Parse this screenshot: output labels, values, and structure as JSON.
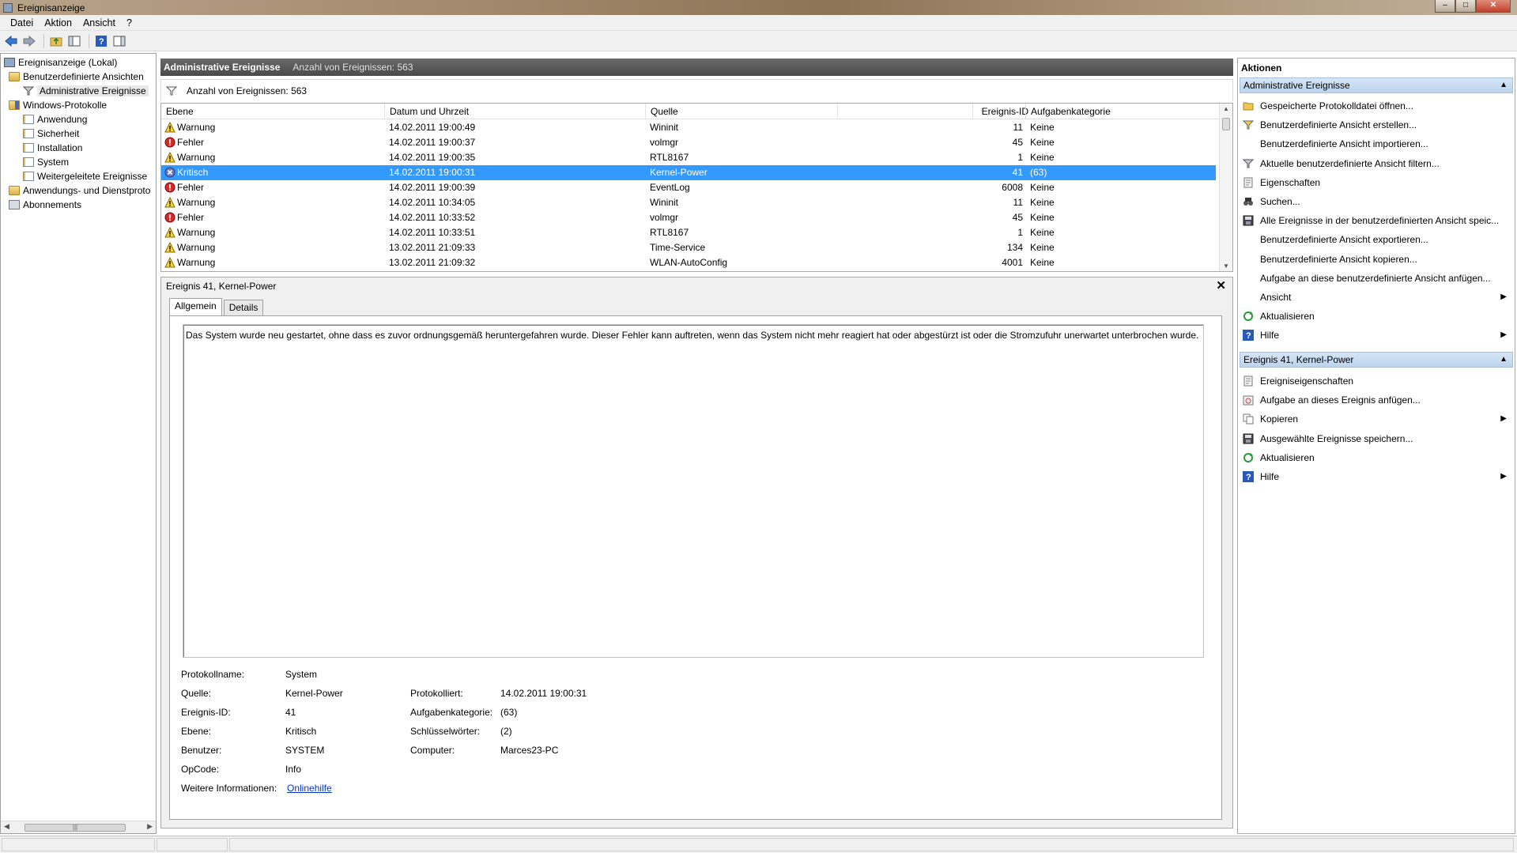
{
  "window": {
    "title": "Ereignisanzeige",
    "controls": {
      "minimize": "–",
      "maximize": "□",
      "close": "✕"
    }
  },
  "menu": [
    "Datei",
    "Aktion",
    "Ansicht",
    "?"
  ],
  "toolbar": {
    "icons": [
      "back-arrow",
      "forward-arrow",
      "up-folder",
      "show-hide-tree",
      "help",
      "show-hide-actions"
    ]
  },
  "tree": [
    {
      "label": "Ereignisanzeige (Lokal)",
      "icon": "computer",
      "level": 0
    },
    {
      "label": "Benutzerdefinierte Ansichten",
      "icon": "folder",
      "level": 1
    },
    {
      "label": "Administrative Ereignisse",
      "icon": "filter",
      "level": 2,
      "selected": true
    },
    {
      "label": "Windows-Protokolle",
      "icon": "folder",
      "level": 1
    },
    {
      "label": "Anwendung",
      "icon": "log",
      "level": 2
    },
    {
      "label": "Sicherheit",
      "icon": "log",
      "level": 2
    },
    {
      "label": "Installation",
      "icon": "log",
      "level": 2
    },
    {
      "label": "System",
      "icon": "log",
      "level": 2
    },
    {
      "label": "Weitergeleitete Ereignisse",
      "icon": "log",
      "level": 2
    },
    {
      "label": "Anwendungs- und Dienstproto",
      "icon": "folder",
      "level": 1
    },
    {
      "label": "Abonnements",
      "icon": "subscriptions",
      "level": 1
    }
  ],
  "center": {
    "header_title": "Administrative Ereignisse",
    "header_count": "Anzahl von Ereignissen: 563",
    "filter_text": "Anzahl von Ereignissen: 563",
    "columns": [
      "Ebene",
      "Datum und Uhrzeit",
      "Quelle",
      "Ereignis-ID",
      "Aufgabenkategorie"
    ],
    "rows": [
      {
        "level": "Warnung",
        "type": "warning",
        "datetime": "14.02.2011 19:00:49",
        "source": "Wininit",
        "id": "11",
        "category": "Keine"
      },
      {
        "level": "Fehler",
        "type": "error",
        "datetime": "14.02.2011 19:00:37",
        "source": "volmgr",
        "id": "45",
        "category": "Keine"
      },
      {
        "level": "Warnung",
        "type": "warning",
        "datetime": "14.02.2011 19:00:35",
        "source": "RTL8167",
        "id": "1",
        "category": "Keine"
      },
      {
        "level": "Kritisch",
        "type": "critical",
        "datetime": "14.02.2011 19:00:31",
        "source": "Kernel-Power",
        "id": "41",
        "category": "(63)",
        "selected": true
      },
      {
        "level": "Fehler",
        "type": "error",
        "datetime": "14.02.2011 19:00:39",
        "source": "EventLog",
        "id": "6008",
        "category": "Keine"
      },
      {
        "level": "Warnung",
        "type": "warning",
        "datetime": "14.02.2011 10:34:05",
        "source": "Wininit",
        "id": "11",
        "category": "Keine"
      },
      {
        "level": "Fehler",
        "type": "error",
        "datetime": "14.02.2011 10:33:52",
        "source": "volmgr",
        "id": "45",
        "category": "Keine"
      },
      {
        "level": "Warnung",
        "type": "warning",
        "datetime": "14.02.2011 10:33:51",
        "source": "RTL8167",
        "id": "1",
        "category": "Keine"
      },
      {
        "level": "Warnung",
        "type": "warning",
        "datetime": "13.02.2011 21:09:33",
        "source": "Time-Service",
        "id": "134",
        "category": "Keine"
      },
      {
        "level": "Warnung",
        "type": "warning",
        "datetime": "13.02.2011 21:09:32",
        "source": "WLAN-AutoConfig",
        "id": "4001",
        "category": "Keine"
      }
    ]
  },
  "detail": {
    "title": "Ereignis 41, Kernel-Power",
    "close": "✕",
    "tabs": [
      "Allgemein",
      "Details"
    ],
    "description": "Das System wurde neu gestartet, ohne dass es zuvor ordnungsgemäß heruntergefahren wurde. Dieser Fehler kann auftreten, wenn das System nicht mehr reagiert hat oder abgestürzt ist oder die Stromzufuhr unerwartet unterbrochen wurde.",
    "props": {
      "protokollname_label": "Protokollname:",
      "protokollname": "System",
      "quelle_label": "Quelle:",
      "quelle": "Kernel-Power",
      "protokolliert_label": "Protokolliert:",
      "protokolliert": "14.02.2011 19:00:31",
      "ereignis_id_label": "Ereignis-ID:",
      "ereignis_id": "41",
      "aufgabenkategorie_label": "Aufgabenkategorie:",
      "aufgabenkategorie": "(63)",
      "ebene_label": "Ebene:",
      "ebene": "Kritisch",
      "schluesselwoerter_label": "Schlüsselwörter:",
      "schluesselwoerter": "(2)",
      "benutzer_label": "Benutzer:",
      "benutzer": "SYSTEM",
      "computer_label": "Computer:",
      "computer": "Marces23-PC",
      "opcode_label": "OpCode:",
      "opcode": "Info",
      "weitere_label": "Weitere Informationen:",
      "weitere_link": "Onlinehilfe"
    }
  },
  "actions": {
    "title": "Aktionen",
    "section1": "Administrative Ereignisse",
    "section1_items": [
      {
        "label": "Gespeicherte Protokolldatei öffnen...",
        "icon": "folder-open"
      },
      {
        "label": "Benutzerdefinierte Ansicht erstellen...",
        "icon": "filter-create"
      },
      {
        "label": "Benutzerdefinierte Ansicht importieren...",
        "icon": ""
      },
      {
        "label": "Aktuelle benutzerdefinierte Ansicht filtern...",
        "icon": "filter"
      },
      {
        "label": "Eigenschaften",
        "icon": "properties"
      },
      {
        "label": "Suchen...",
        "icon": "binoculars"
      },
      {
        "label": "Alle Ereignisse in der benutzerdefinierten Ansicht speic...",
        "icon": "save"
      },
      {
        "label": "Benutzerdefinierte Ansicht exportieren...",
        "icon": ""
      },
      {
        "label": "Benutzerdefinierte Ansicht kopieren...",
        "icon": ""
      },
      {
        "label": "Aufgabe an diese benutzerdefinierte Ansicht anfügen...",
        "icon": ""
      },
      {
        "label": "Ansicht",
        "icon": "",
        "submenu": "▶"
      },
      {
        "label": "Aktualisieren",
        "icon": "refresh"
      },
      {
        "label": "Hilfe",
        "icon": "help",
        "submenu": "▶"
      }
    ],
    "section2": "Ereignis 41, Kernel-Power",
    "section2_items": [
      {
        "label": "Ereigniseigenschaften",
        "icon": "properties"
      },
      {
        "label": "Aufgabe an dieses Ereignis anfügen...",
        "icon": "task"
      },
      {
        "label": "Kopieren",
        "icon": "copy",
        "submenu": "▶"
      },
      {
        "label": "Ausgewählte Ereignisse speichern...",
        "icon": "save"
      },
      {
        "label": "Aktualisieren",
        "icon": "refresh"
      },
      {
        "label": "Hilfe",
        "icon": "help",
        "submenu": "▶"
      }
    ],
    "collapse": "▲"
  },
  "colors": {
    "selection": "#3399ff",
    "header_dark": "#4a4a4a",
    "action_section": "#bcd4ee",
    "link": "#0033cc"
  }
}
